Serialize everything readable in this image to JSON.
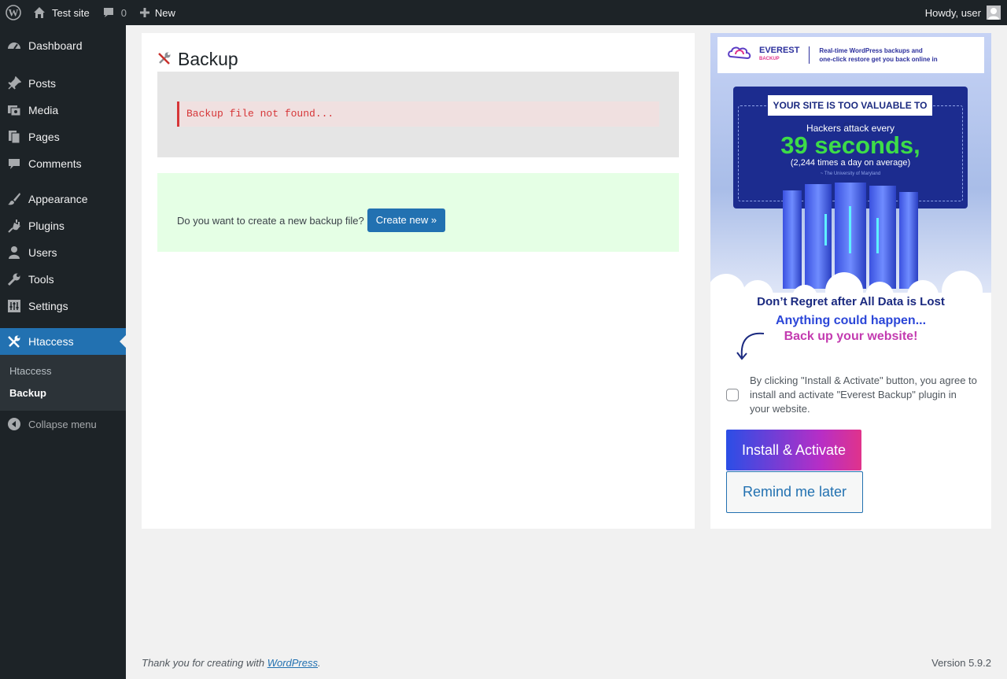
{
  "adminbar": {
    "site_name": "Test site",
    "comments_count": "0",
    "new_label": "New",
    "greeting": "Howdy, user"
  },
  "sidebar": {
    "items": [
      {
        "label": "Dashboard",
        "icon": "dashboard-icon"
      },
      {
        "label": "Posts",
        "icon": "pin-icon"
      },
      {
        "label": "Media",
        "icon": "media-icon"
      },
      {
        "label": "Pages",
        "icon": "pages-icon"
      },
      {
        "label": "Comments",
        "icon": "comment-icon"
      },
      {
        "label": "Appearance",
        "icon": "brush-icon"
      },
      {
        "label": "Plugins",
        "icon": "plug-icon"
      },
      {
        "label": "Users",
        "icon": "user-icon"
      },
      {
        "label": "Tools",
        "icon": "wrench-icon"
      },
      {
        "label": "Settings",
        "icon": "settings-icon"
      },
      {
        "label": "Htaccess",
        "icon": "tools-icon"
      }
    ],
    "submenu": [
      "Htaccess",
      "Backup"
    ],
    "collapse_label": "Collapse menu"
  },
  "main": {
    "title": "Backup",
    "error_message": "Backup file not found...",
    "create_question": "Do you want to create a new backup file?",
    "create_button": "Create new »"
  },
  "promo": {
    "brand": "EVEREST",
    "brand_sub": "BACKUP",
    "tagline_1": "Real-time WordPress backups and",
    "tagline_2": "one-click restore get you back online in",
    "headline": "YOUR SITE IS TOO VALUABLE TO LOSE",
    "line_1": "Hackers attack every",
    "line_2": "39 seconds,",
    "line_3": "(2,244 times a day on average)",
    "line_4": "~ The University of Maryland",
    "sub_1": "Don’t Regret after All Data is Lost",
    "sub_2": "Anything could happen...",
    "sub_3": "Back up your website!",
    "consent_text": "By clicking \"Install & Activate\" button, you agree to install and activate \"Everest Backup\" plugin in your website.",
    "install_button": "Install & Activate",
    "remind_button": "Remind me later"
  },
  "footer": {
    "thanks_prefix": "Thank you for creating with ",
    "wordpress_link": "WordPress",
    "thanks_suffix": ".",
    "version": "Version 5.9.2"
  },
  "colors": {
    "admin_dark": "#1d2327",
    "accent_blue": "#2271b1",
    "error_red": "#d63638",
    "success_bg": "#e5ffe5"
  }
}
